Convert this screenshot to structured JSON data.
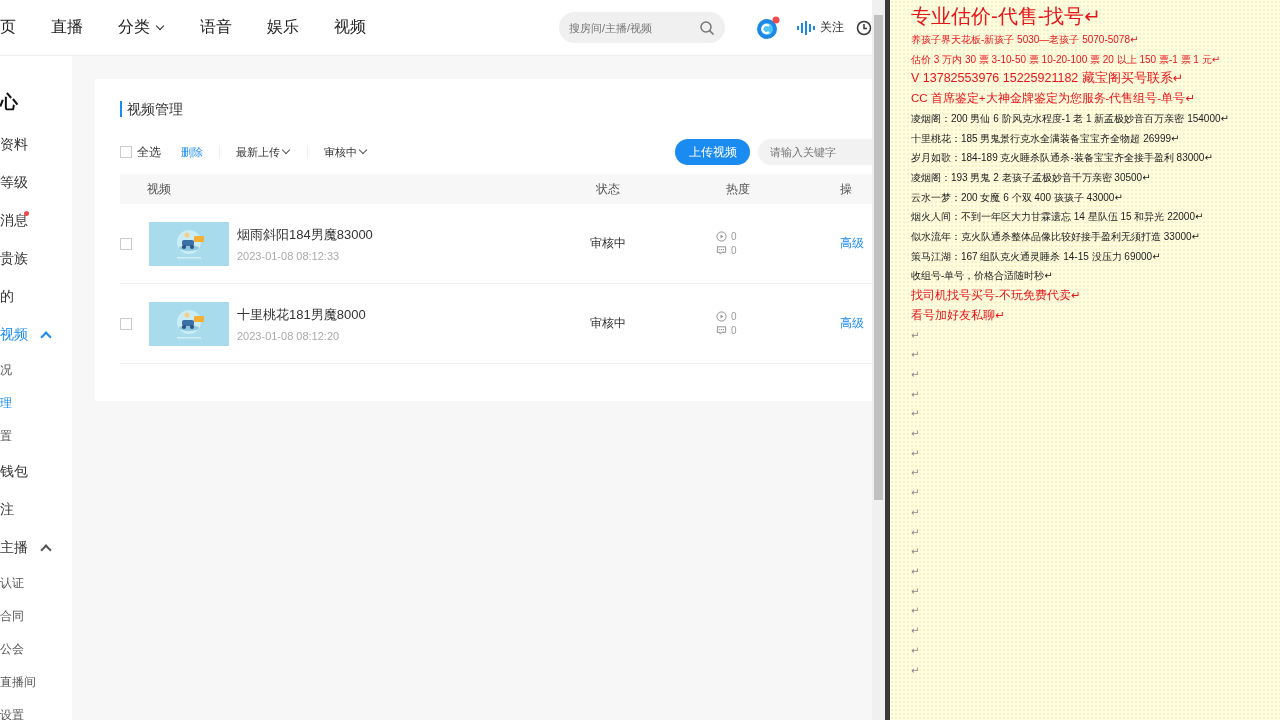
{
  "nav": {
    "items": [
      {
        "label": "页",
        "dropdown": false
      },
      {
        "label": "直播",
        "dropdown": false
      },
      {
        "label": "分类",
        "dropdown": true
      },
      {
        "label": "语音",
        "dropdown": false
      },
      {
        "label": "娱乐",
        "dropdown": false
      },
      {
        "label": "视频",
        "dropdown": false
      }
    ],
    "search": {
      "placeholder": "搜房间/主播/视频"
    },
    "follow": "关注"
  },
  "sidebar": {
    "items": [
      {
        "label": "心",
        "kind": "heading",
        "selected": false,
        "dot": false
      },
      {
        "label": "资料",
        "kind": "item",
        "selected": false,
        "dot": false
      },
      {
        "label": "等级",
        "kind": "item",
        "selected": false,
        "dot": false
      },
      {
        "label": "消息",
        "kind": "item",
        "selected": false,
        "dot": true
      },
      {
        "label": "贵族",
        "kind": "item",
        "selected": false,
        "dot": false
      },
      {
        "label": "的",
        "kind": "item",
        "selected": false,
        "dot": false
      },
      {
        "label": "视频",
        "kind": "group",
        "expanded": true,
        "selected": true,
        "dot": false
      },
      {
        "label": "况",
        "kind": "sub",
        "selected": false,
        "dot": false
      },
      {
        "label": "理",
        "kind": "sub",
        "selected": true,
        "dot": false
      },
      {
        "label": "置",
        "kind": "sub",
        "selected": false,
        "dot": false
      },
      {
        "label": "钱包",
        "kind": "item",
        "selected": false,
        "dot": false
      },
      {
        "label": "注",
        "kind": "item",
        "selected": false,
        "dot": false
      },
      {
        "label": "主播",
        "kind": "group",
        "expanded": true,
        "selected": false,
        "dot": false
      },
      {
        "label": "认证",
        "kind": "sub",
        "selected": false,
        "dot": false
      },
      {
        "label": "合同",
        "kind": "sub",
        "selected": false,
        "dot": false
      },
      {
        "label": "公会",
        "kind": "sub",
        "selected": false,
        "dot": false
      },
      {
        "label": "直播间",
        "kind": "sub",
        "selected": false,
        "dot": false
      },
      {
        "label": "设置",
        "kind": "sub",
        "selected": false,
        "dot": false
      }
    ]
  },
  "card": {
    "title": "视频管理",
    "select_all": {
      "label": "全选",
      "checked": false
    },
    "delete": "删除",
    "sort": "最新上传",
    "filter": "审核中",
    "upload": "上传视频",
    "search": {
      "placeholder": "请输入关键字"
    }
  },
  "table": {
    "columns": [
      "视频",
      "状态",
      "热度",
      "操"
    ],
    "rows": [
      {
        "selected": false,
        "title": "烟雨斜阳184男魔83000",
        "date": "2023-01-08 08:12:33",
        "status": "审核中",
        "plays": "0",
        "comments": "0",
        "action": "高级"
      },
      {
        "selected": false,
        "title": "十里桃花181男魔8000",
        "date": "2023-01-08 08:12:20",
        "status": "审核中",
        "plays": "0",
        "comments": "0",
        "action": "高级"
      }
    ]
  },
  "document": {
    "lines": [
      {
        "kind": "title",
        "text": "专业估价-代售-找号↵"
      },
      {
        "kind": "red",
        "text": "养孩子界天花板-新孩子 5030—老孩子 5070-5078↵"
      },
      {
        "kind": "red",
        "text": "估价 3 万内 30 票  3-10-50 票  10-20-100 票 20 以上 150 票-1 票 1 元↵"
      },
      {
        "kind": "red_large",
        "text": "V 13782553976    15225921182  藏宝阁买号联系↵"
      },
      {
        "kind": "red_medium",
        "text": "CC 首席鉴定+大神金牌鉴定为您服务-代售组号-单号↵"
      },
      {
        "kind": "dark",
        "text": "凌烟阁：200 男仙 6 阶风克水程度-1 老 1 新孟极妙音百万亲密 154000↵"
      },
      {
        "kind": "dark",
        "text": "十里桃花：185 男鬼景行克水全满装备宝宝齐全物超 26999↵"
      },
      {
        "kind": "dark",
        "text": "岁月如歌：184-189 克火睡杀队通杀-装备宝宝齐全接手盈利 83000↵"
      },
      {
        "kind": "dark",
        "text": "凌烟阁：193 男鬼 2 老孩子孟极妙音千万亲密 30500↵"
      },
      {
        "kind": "dark",
        "text": "云水一梦：200 女魔 6 个双 400 孩孩子 43000↵"
      },
      {
        "kind": "dark",
        "text": "烟火人间：不到一年区大力甘霖遗忘 14 星队伍 15 和异光 22000↵"
      },
      {
        "kind": "dark",
        "text": "似水流年：克火队通杀整体品像比较好接手盈利无须打造 33000↵"
      },
      {
        "kind": "dark",
        "text": "策马江湖：167 组队克火通灵睡杀 14-15 没压力 69000↵"
      },
      {
        "kind": "dark",
        "text": "收组号-单号，价格合适随时秒↵"
      },
      {
        "kind": "red_medium",
        "text": "找司机找号买号-不玩免费代卖↵"
      },
      {
        "kind": "red_medium",
        "text": "看号加好友私聊↵"
      },
      {
        "kind": "mark",
        "text": "↵"
      },
      {
        "kind": "mark",
        "text": "↵"
      },
      {
        "kind": "mark",
        "text": "↵"
      },
      {
        "kind": "mark",
        "text": "↵"
      },
      {
        "kind": "mark",
        "text": "↵"
      },
      {
        "kind": "mark",
        "text": "↵"
      },
      {
        "kind": "mark",
        "text": "↵"
      },
      {
        "kind": "mark",
        "text": "↵"
      },
      {
        "kind": "mark",
        "text": "↵"
      },
      {
        "kind": "mark",
        "text": "↵"
      },
      {
        "kind": "mark",
        "text": "↵"
      },
      {
        "kind": "mark",
        "text": "↵"
      },
      {
        "kind": "mark",
        "text": "↵"
      },
      {
        "kind": "mark",
        "text": "↵"
      },
      {
        "kind": "mark",
        "text": "↵"
      },
      {
        "kind": "mark",
        "text": "↵"
      },
      {
        "kind": "mark",
        "text": "↵"
      },
      {
        "kind": "mark",
        "text": "↵"
      }
    ]
  }
}
